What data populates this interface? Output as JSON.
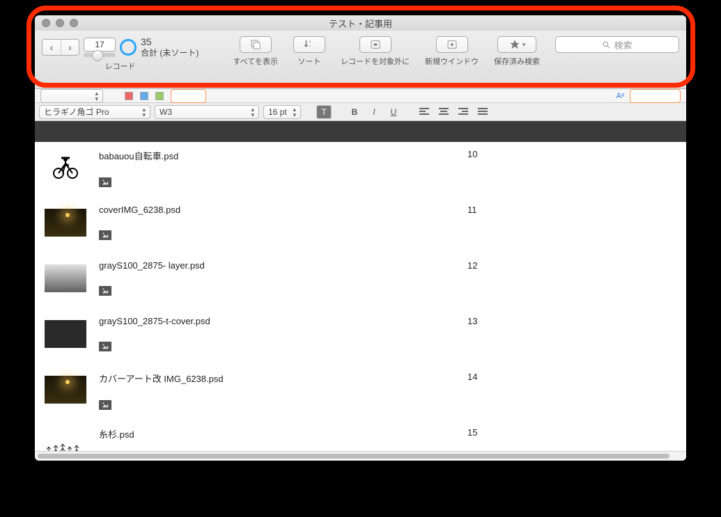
{
  "window": {
    "title": "テスト・記事用"
  },
  "toolbar": {
    "record_label": "レコード",
    "current_record": "17",
    "count_number": "35",
    "count_text": "合計 (未ソート)",
    "show_all": "すべてを表示",
    "sort": "ソート",
    "exclude": "レコードを対象外に",
    "new_window": "新規ウインドウ",
    "saved_search": "保存済み検索",
    "search_placeholder": "検索"
  },
  "format": {
    "font": "ヒラギノ角ゴ Pro",
    "weight": "W3",
    "size": "16 pt"
  },
  "rows": [
    {
      "name": "babauou自転車.psd",
      "num": "10",
      "thumb": "bike"
    },
    {
      "name": "coverIMG_6238.psd",
      "num": "11",
      "thumb": "night"
    },
    {
      "name": "grayS100_2875- layer.psd",
      "num": "12",
      "thumb": "graylight"
    },
    {
      "name": "grayS100_2875-t-cover.psd",
      "num": "13",
      "thumb": "gray"
    },
    {
      "name": "カバーアート改 IMG_6238.psd",
      "num": "14",
      "thumb": "night"
    },
    {
      "name": "糸杉.psd",
      "num": "15",
      "thumb": "trees"
    }
  ]
}
